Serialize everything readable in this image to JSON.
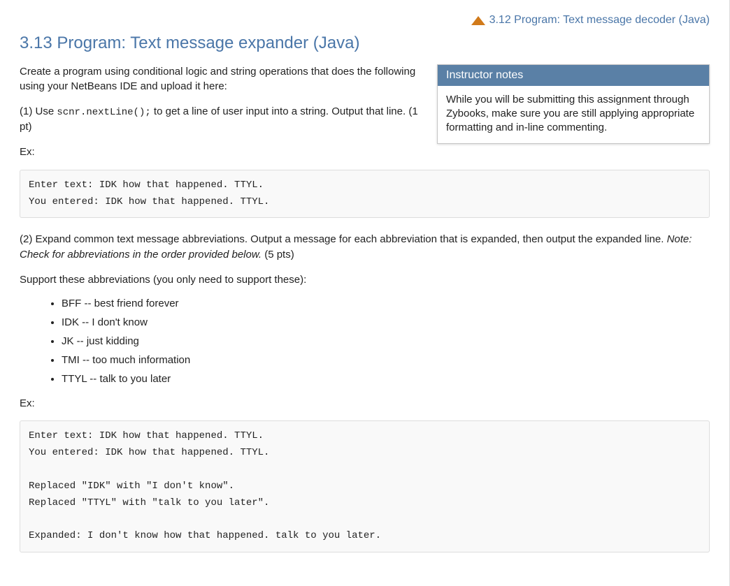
{
  "nav": {
    "prev_label": "3.12 Program: Text message decoder (Java)"
  },
  "title": "3.13 Program: Text message expander (Java)",
  "intro": "Create a program using conditional logic and string operations that does the following using your NetBeans IDE and upload it here:",
  "instructor": {
    "header": "Instructor notes",
    "body": "While you will be submitting this assignment through Zybooks, make sure you are still applying appropriate formatting and in-line commenting."
  },
  "step1": {
    "prefix": "(1) Use ",
    "code": "scnr.nextLine();",
    "suffix": " to get a line of user input into a string. Output that line. (1 pt)"
  },
  "ex_label": "Ex:",
  "code1": "Enter text: IDK how that happened. TTYL.\nYou entered: IDK how that happened. TTYL.",
  "step2": {
    "main": "(2) Expand common text message abbreviations. Output a message for each abbreviation that is expanded, then output the expanded line. ",
    "note": "Note: Check for abbreviations in the order provided below.",
    "pts": " (5 pts)"
  },
  "support_label": "Support these abbreviations (you only need to support these):",
  "abbrevs": [
    "BFF -- best friend forever",
    "IDK -- I don't know",
    "JK -- just kidding",
    "TMI -- too much information",
    "TTYL -- talk to you later"
  ],
  "code2": "Enter text: IDK how that happened. TTYL.\nYou entered: IDK how that happened. TTYL.\n\nReplaced \"IDK\" with \"I don't know\".\nReplaced \"TTYL\" with \"talk to you later\".\n\nExpanded: I don't know how that happened. talk to you later."
}
